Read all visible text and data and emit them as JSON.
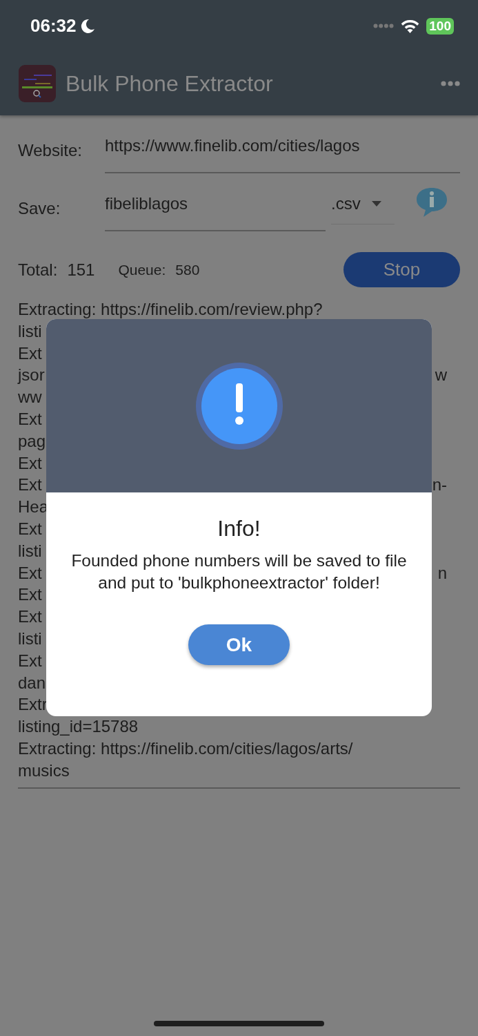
{
  "status_bar": {
    "time": "06:32",
    "battery": "100"
  },
  "app_bar": {
    "title": "Bulk Phone Extractor"
  },
  "form": {
    "website_label": "Website:",
    "website_value": "https://www.finelib.com/cities/lagos",
    "save_label": "Save:",
    "save_value": "fibeliblagos",
    "format": ".csv"
  },
  "stats": {
    "total_label": "Total:",
    "total": "151",
    "queue_label": "Queue:",
    "queue": "580",
    "stop_button": "Stop"
  },
  "log": [
    {
      "left": "Extracting: https://finelib.com/review.php?"
    },
    {
      "left": "listi"
    },
    {
      "left": "Ext"
    },
    {
      "left": "jsor",
      "right": "w"
    },
    {
      "left": "ww"
    },
    {
      "left": "Ext"
    },
    {
      "left": "pag"
    },
    {
      "left": "Ext"
    },
    {
      "left": "Ext",
      "right": "n-"
    },
    {
      "left": "Hea"
    },
    {
      "left": "Ext"
    },
    {
      "left": "listi"
    },
    {
      "left": "Ext",
      "right": "n"
    },
    {
      "left": "Ext"
    },
    {
      "left": "Ext"
    },
    {
      "left": "listi"
    },
    {
      "left": "Ext"
    },
    {
      "left": "dan"
    },
    {
      "left": "Extr"
    },
    {
      "left": "listing_id=15788"
    },
    {
      "left": "Extracting: https://finelib.com/cities/lagos/arts/"
    },
    {
      "left": "musics"
    }
  ],
  "dialog": {
    "title": "Info!",
    "message": "Founded phone numbers will be saved to file and put to 'bulkphoneextractor' folder!",
    "button": "Ok"
  }
}
